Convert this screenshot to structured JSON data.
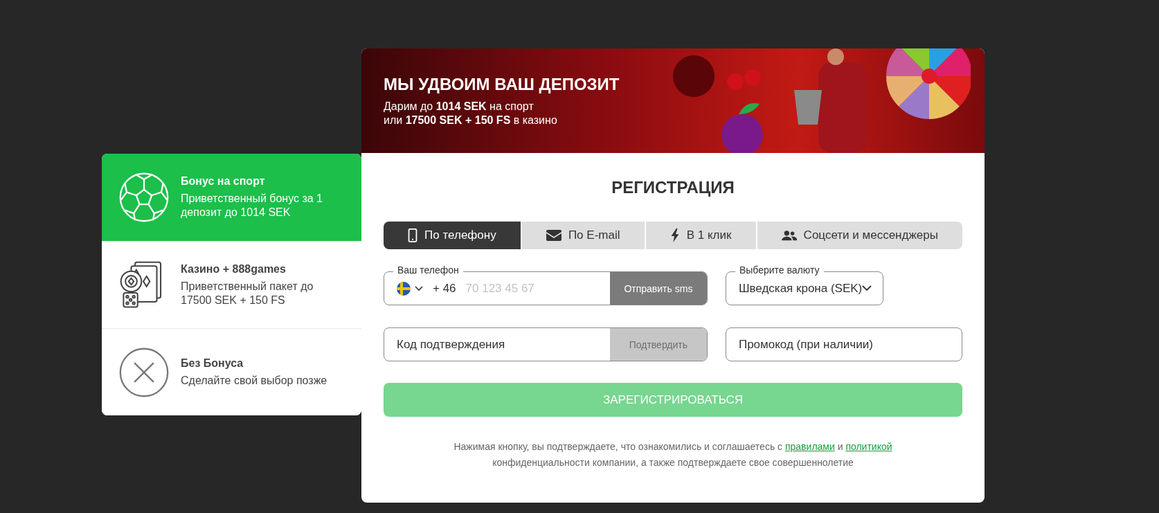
{
  "banner": {
    "title": "МЫ УДВОИМ ВАШ ДЕПОЗИТ",
    "lines": [
      "Дарим до **1014 SEK** на спорт",
      "или **17500 SEK + 150 FS** в казино"
    ]
  },
  "bonuses": [
    {
      "kind": "sport",
      "title": "Бонус на спорт",
      "description": "Приветственный бонус за 1 депозит до 1014 SEK",
      "selected": true
    },
    {
      "kind": "casino",
      "title": "Казино + 888games",
      "description": "Приветственный пакет до 17500 SEK + 150 FS",
      "selected": false
    },
    {
      "kind": "none",
      "title": "Без Бонуса",
      "description": "Сделайте свой выбор позже",
      "selected": false
    }
  ],
  "form": {
    "title": "РЕГИСТРАЦИЯ",
    "tabs": [
      {
        "kind": "phone",
        "label": "По телефону",
        "selected": true
      },
      {
        "kind": "email",
        "label": "По E-mail",
        "selected": false
      },
      {
        "kind": "oneclick",
        "label": "В 1 клик",
        "selected": false
      },
      {
        "kind": "social",
        "label": "Соцсети и мессенджеры",
        "selected": false
      }
    ],
    "phone": {
      "label": "Ваш телефон",
      "country_code": "+ 46",
      "placeholder": "70 123 45 67",
      "button": "Отправить sms"
    },
    "currency": {
      "label": "Выберите валюту",
      "value": "Шведская крона (SEK)"
    },
    "code": {
      "placeholder": "Код подтверждения",
      "button": "Подтвердить",
      "disabled": true
    },
    "promo": {
      "placeholder": "Промокод (при наличии)"
    },
    "submit": {
      "label": "ЗАРЕГИСТРИРОВАТЬСЯ",
      "disabled": true
    },
    "consent": {
      "before": "Нажимая кнопку, вы подтверждаете, что ознакомились и соглашаетесь с ",
      "link_1": "правилами",
      "middle": " и ",
      "link_2": "политикой",
      "after": " конфиденциальности компании, а также подтверждаете свое совершеннолетие"
    }
  }
}
